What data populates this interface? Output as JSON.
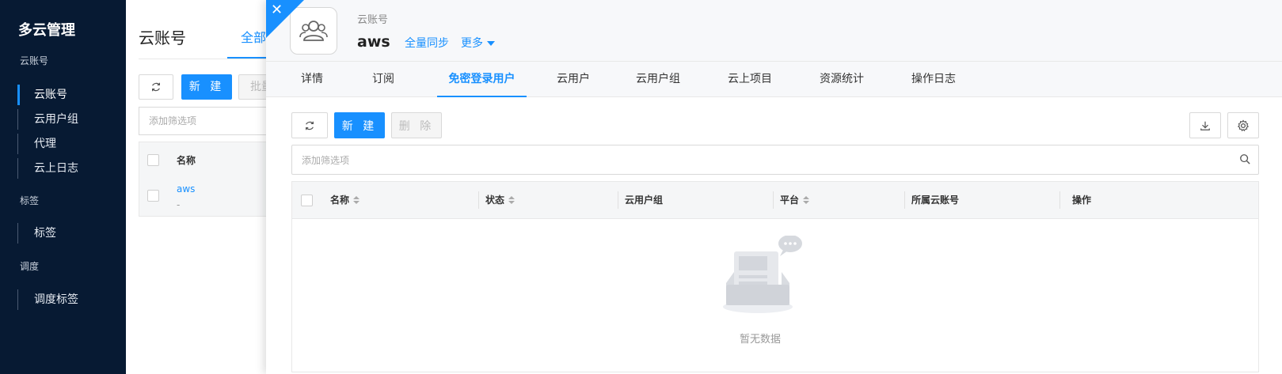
{
  "sidebar": {
    "title": "多云管理",
    "groups": [
      {
        "title": "云账号",
        "items": [
          "云账号",
          "云用户组",
          "代理",
          "云上日志"
        ]
      },
      {
        "title": "标签",
        "items": [
          "标签"
        ]
      },
      {
        "title": "调度",
        "items": [
          "调度标签"
        ]
      }
    ]
  },
  "background_page": {
    "title": "云账号",
    "tab_label": "全部",
    "buttons": {
      "new": "新 建",
      "batch": "批量"
    },
    "filter_placeholder": "添加筛选项",
    "column_name": "名称",
    "row": {
      "name": "aws",
      "sub": "-"
    }
  },
  "drawer": {
    "close_icon": "close-icon",
    "type_label": "云账号",
    "name": "aws",
    "actions": {
      "sync": "全量同步",
      "more": "更多"
    },
    "tabs": [
      "详情",
      "订阅",
      "免密登录用户",
      "云用户",
      "云用户组",
      "云上项目",
      "资源统计",
      "操作日志"
    ],
    "active_tab": "免密登录用户",
    "toolbar": {
      "new": "新 建",
      "delete": "删 除"
    },
    "filter_placeholder": "添加筛选项",
    "columns": [
      "名称",
      "状态",
      "云用户组",
      "平台",
      "所属云账号",
      "操作"
    ],
    "empty_text": "暂无数据"
  },
  "colors": {
    "accent": "#1890ff",
    "sidebar_bg": "#071a33"
  }
}
